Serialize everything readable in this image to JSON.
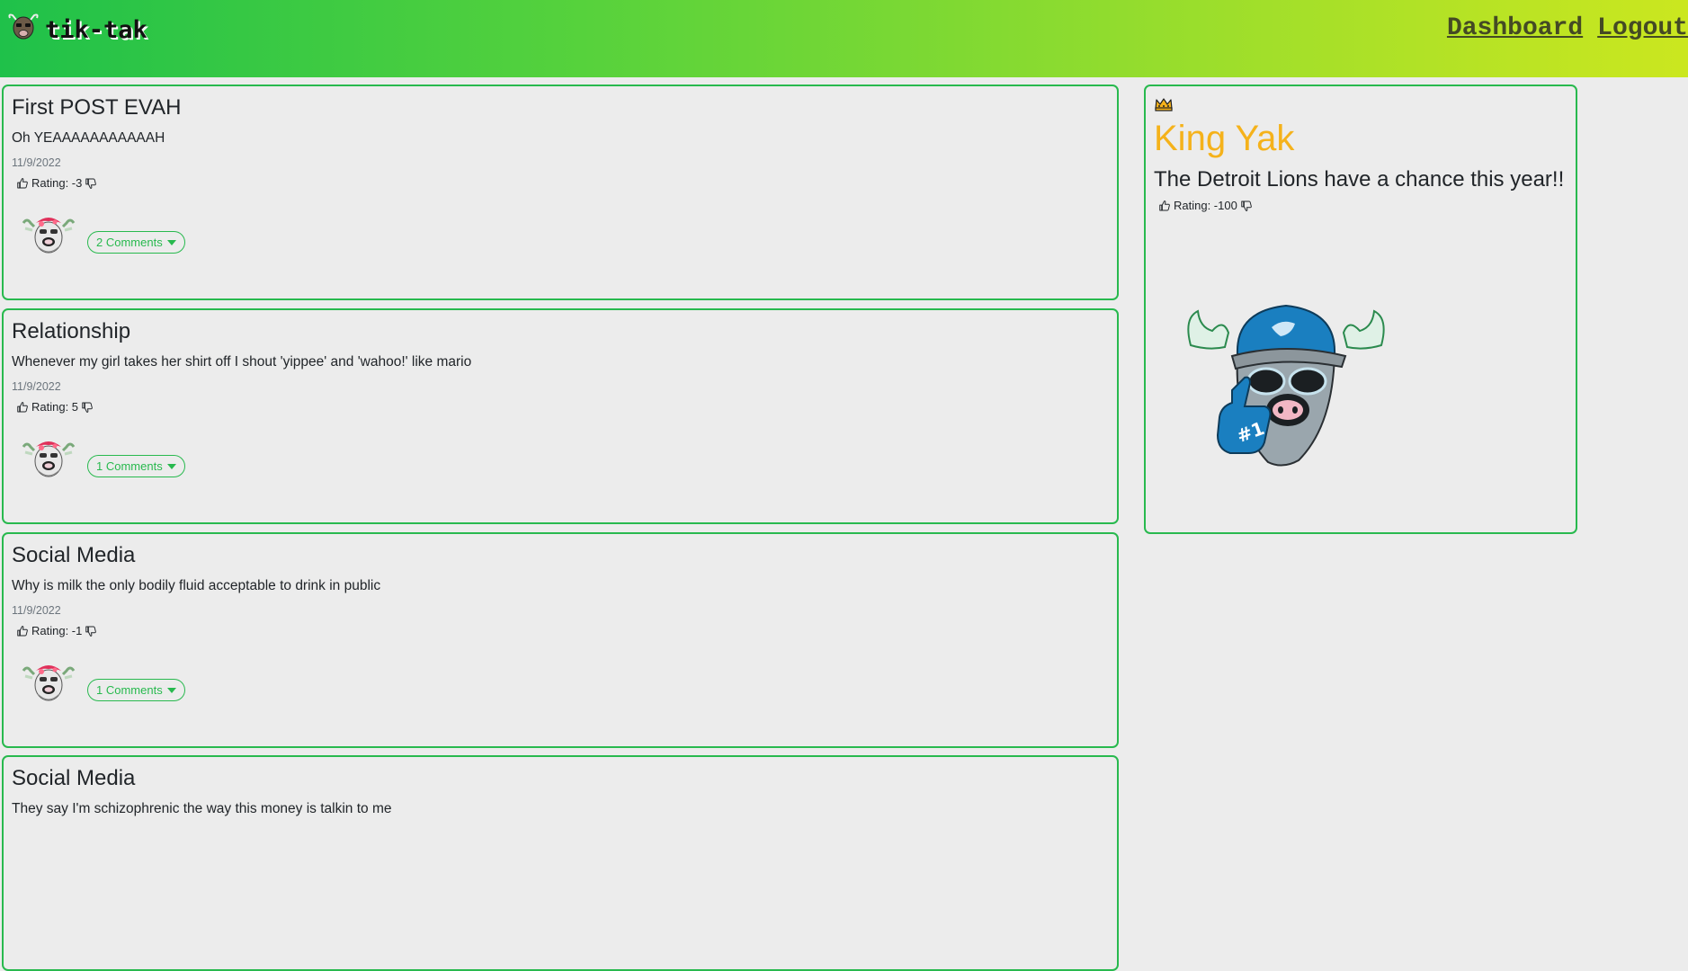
{
  "brand": {
    "name": "tik-tak",
    "logo_icon": "yak-logo-icon"
  },
  "nav": {
    "dashboard": "Dashboard",
    "logout": "Logout"
  },
  "colors": {
    "accent": "#28b94e",
    "king": "#f5b21b",
    "nav_gradient_start": "#1fc14a",
    "nav_gradient_end": "#cbe71f"
  },
  "posts": [
    {
      "title": "First POST EVAH",
      "body": "Oh YEAAAAAAAAAAAH",
      "date": "11/9/2022",
      "rating": "Rating: -3",
      "comments": "2 Comments"
    },
    {
      "title": "Relationship",
      "body": "Whenever my girl takes her shirt off I shout 'yippee' and 'wahoo!' like mario",
      "date": "11/9/2022",
      "rating": "Rating: 5",
      "comments": "1 Comments"
    },
    {
      "title": "Social Media",
      "body": "Why is milk the only bodily fluid acceptable to drink in public",
      "date": "11/9/2022",
      "rating": "Rating: -1",
      "comments": "1 Comments"
    },
    {
      "title": "Social Media",
      "body": "They say I'm schizophrenic the way this money is talkin to me",
      "date": "",
      "rating": "",
      "comments": ""
    }
  ],
  "king": {
    "crown_icon": "crown-icon",
    "title": "King Yak",
    "post": "The Detroit Lions have a chance this year!!",
    "rating": "Rating: -100",
    "avatar_icon": "lions-yak-avatar"
  }
}
